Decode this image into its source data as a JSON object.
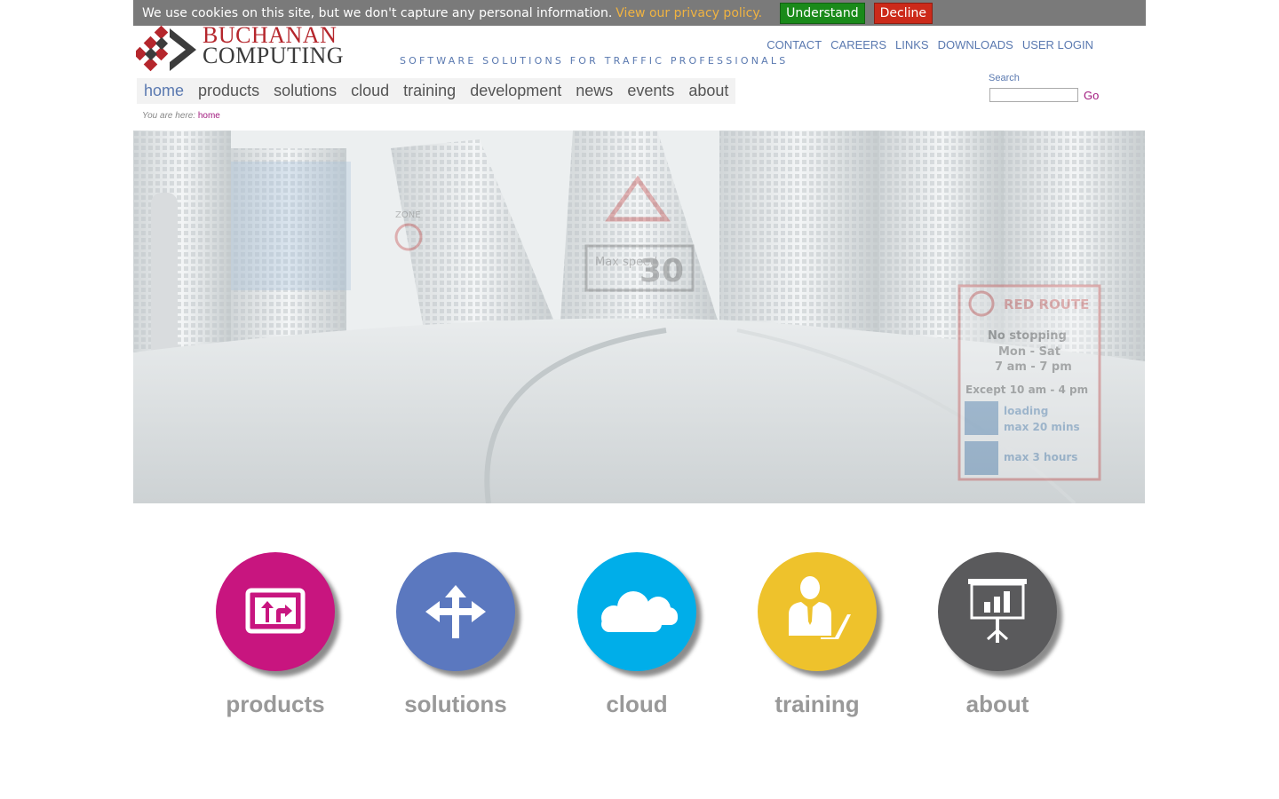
{
  "cookie": {
    "message": "We use cookies on this site, but we don't capture any personal information.",
    "policy_link": "View our privacy policy.",
    "understand": "Understand",
    "decline": "Decline"
  },
  "logo": {
    "line1": "BUCHANAN",
    "line2": "COMPUTING",
    "tagline": "SOFTWARE SOLUTIONS FOR TRAFFIC PROFESSIONALS"
  },
  "top_links": [
    "CONTACT",
    "CAREERS",
    "LINKS",
    "DOWNLOADS",
    "USER LOGIN"
  ],
  "nav": [
    "home",
    "products",
    "solutions",
    "cloud",
    "training",
    "development",
    "news",
    "events",
    "about"
  ],
  "search": {
    "label": "Search",
    "value": "",
    "go": "Go"
  },
  "breadcrumb": {
    "prefix": "You are here:",
    "current": "home"
  },
  "hero": {
    "signs": [
      "RED ROUTE",
      "No stopping",
      "Mon - Sat",
      "7 am - 7 pm",
      "Except 10 am - 4 pm",
      "loading",
      "max 20 mins",
      "max 3 hours",
      "Max speed",
      "30",
      "ZONE"
    ]
  },
  "features": [
    {
      "label": "products",
      "color": "#c8157f",
      "icon": "sign-arrows-icon"
    },
    {
      "label": "solutions",
      "color": "#5b78bf",
      "icon": "four-way-arrows-icon"
    },
    {
      "label": "cloud",
      "color": "#00aee9",
      "icon": "cloud-icon"
    },
    {
      "label": "training",
      "color": "#eec22c",
      "icon": "trainer-laptop-icon"
    },
    {
      "label": "about",
      "color": "#5a5a5c",
      "icon": "presentation-board-icon"
    }
  ]
}
